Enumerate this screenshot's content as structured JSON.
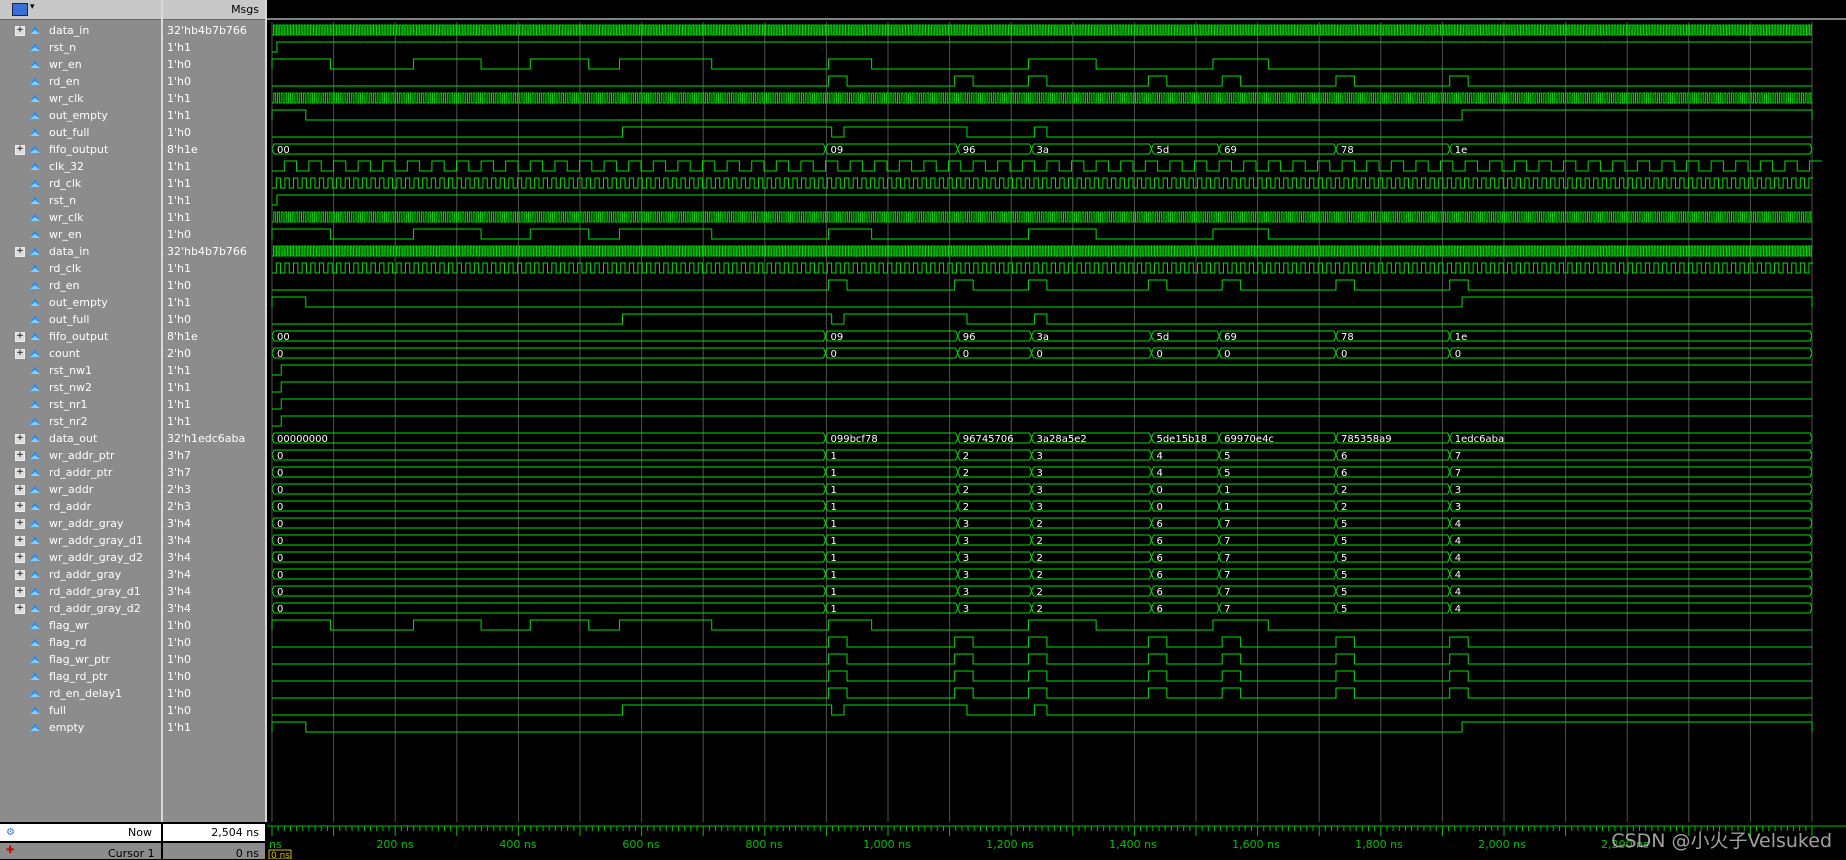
{
  "header": {
    "msgs_label": "Msgs"
  },
  "signals": [
    {
      "name": "data_in",
      "value": "32'hb4b7b766",
      "expand": true,
      "icon": "bus-icon"
    },
    {
      "name": "rst_n",
      "value": "1'h1",
      "expand": false,
      "icon": "wire-icon"
    },
    {
      "name": "wr_en",
      "value": "1'h0",
      "expand": false,
      "icon": "wire-icon"
    },
    {
      "name": "rd_en",
      "value": "1'h0",
      "expand": false,
      "icon": "wire-icon"
    },
    {
      "name": "wr_clk",
      "value": "1'h1",
      "expand": false,
      "icon": "wire-icon"
    },
    {
      "name": "out_empty",
      "value": "1'h1",
      "expand": false,
      "icon": "output-icon"
    },
    {
      "name": "out_full",
      "value": "1'h0",
      "expand": false,
      "icon": "output-icon"
    },
    {
      "name": "fifo_output",
      "value": "8'h1e",
      "expand": true,
      "icon": "bus-output-icon"
    },
    {
      "name": "clk_32",
      "value": "1'h1",
      "expand": false,
      "icon": "output-icon"
    },
    {
      "name": "rd_clk",
      "value": "1'h1",
      "expand": false,
      "icon": "wire-icon"
    },
    {
      "name": "rst_n",
      "value": "1'h1",
      "expand": false,
      "icon": "wire-icon"
    },
    {
      "name": "wr_clk",
      "value": "1'h1",
      "expand": false,
      "icon": "wire-icon"
    },
    {
      "name": "wr_en",
      "value": "1'h0",
      "expand": false,
      "icon": "wire-icon"
    },
    {
      "name": "data_in",
      "value": "32'hb4b7b766",
      "expand": true,
      "icon": "bus-icon"
    },
    {
      "name": "rd_clk",
      "value": "1'h1",
      "expand": false,
      "icon": "wire-icon"
    },
    {
      "name": "rd_en",
      "value": "1'h0",
      "expand": false,
      "icon": "wire-icon"
    },
    {
      "name": "out_empty",
      "value": "1'h1",
      "expand": false,
      "icon": "output-icon"
    },
    {
      "name": "out_full",
      "value": "1'h0",
      "expand": false,
      "icon": "output-icon"
    },
    {
      "name": "fifo_output",
      "value": "8'h1e",
      "expand": true,
      "icon": "bus-output-icon"
    },
    {
      "name": "count",
      "value": "2'h0",
      "expand": true,
      "icon": "bus-icon"
    },
    {
      "name": "rst_nw1",
      "value": "1'h1",
      "expand": false,
      "icon": "reg-icon"
    },
    {
      "name": "rst_nw2",
      "value": "1'h1",
      "expand": false,
      "icon": "reg-icon"
    },
    {
      "name": "rst_nr1",
      "value": "1'h1",
      "expand": false,
      "icon": "reg-icon"
    },
    {
      "name": "rst_nr2",
      "value": "1'h1",
      "expand": false,
      "icon": "reg-icon"
    },
    {
      "name": "data_out",
      "value": "32'h1edc6aba",
      "expand": true,
      "icon": "bus-icon"
    },
    {
      "name": "wr_addr_ptr",
      "value": "3'h7",
      "expand": true,
      "icon": "bus-icon"
    },
    {
      "name": "rd_addr_ptr",
      "value": "3'h7",
      "expand": true,
      "icon": "bus-icon"
    },
    {
      "name": "wr_addr",
      "value": "2'h3",
      "expand": true,
      "icon": "bus-icon"
    },
    {
      "name": "rd_addr",
      "value": "2'h3",
      "expand": true,
      "icon": "bus-icon"
    },
    {
      "name": "wr_addr_gray",
      "value": "3'h4",
      "expand": true,
      "icon": "bus-icon"
    },
    {
      "name": "wr_addr_gray_d1",
      "value": "3'h4",
      "expand": true,
      "icon": "bus-icon"
    },
    {
      "name": "wr_addr_gray_d2",
      "value": "3'h4",
      "expand": true,
      "icon": "bus-icon"
    },
    {
      "name": "rd_addr_gray",
      "value": "3'h4",
      "expand": true,
      "icon": "bus-icon"
    },
    {
      "name": "rd_addr_gray_d1",
      "value": "3'h4",
      "expand": true,
      "icon": "bus-icon"
    },
    {
      "name": "rd_addr_gray_d2",
      "value": "3'h4",
      "expand": true,
      "icon": "bus-icon"
    },
    {
      "name": "flag_wr",
      "value": "1'h0",
      "expand": false,
      "icon": "reg-icon"
    },
    {
      "name": "flag_rd",
      "value": "1'h0",
      "expand": false,
      "icon": "reg-icon"
    },
    {
      "name": "flag_wr_ptr",
      "value": "1'h0",
      "expand": false,
      "icon": "reg-icon"
    },
    {
      "name": "flag_rd_ptr",
      "value": "1'h0",
      "expand": false,
      "icon": "reg-icon"
    },
    {
      "name": "rd_en_delay1",
      "value": "1'h0",
      "expand": false,
      "icon": "reg-icon"
    },
    {
      "name": "full",
      "value": "1'h0",
      "expand": false,
      "icon": "reg-icon"
    },
    {
      "name": "empty",
      "value": "1'h1",
      "expand": false,
      "icon": "reg-icon"
    }
  ],
  "bus_labels": {
    "fifo_output": [
      "00",
      "09",
      "96",
      "3a",
      "5d",
      "69",
      "78",
      "1e"
    ],
    "count": [
      "0",
      "0",
      "0",
      "0",
      "0",
      "0",
      "0",
      "0"
    ],
    "data_out": [
      "00000000",
      "099bcf78",
      "96745706",
      "3a28a5e2",
      "5de15b18",
      "69970e4c",
      "785358a9",
      "1edc6aba"
    ],
    "wr_addr_ptr": [
      "0",
      "1",
      "2",
      "3",
      "4",
      "5",
      "6",
      "7"
    ],
    "rd_addr_ptr": [
      "0",
      "1",
      "2",
      "3",
      "4",
      "5",
      "6",
      "7"
    ],
    "wr_addr": [
      "0",
      "1",
      "2",
      "3",
      "0",
      "1",
      "2",
      "3"
    ],
    "rd_addr": [
      "0",
      "1",
      "2",
      "3",
      "0",
      "1",
      "2",
      "3"
    ],
    "wr_addr_gray": [
      "0",
      "1",
      "3",
      "2",
      "6",
      "7",
      "5",
      "4"
    ],
    "wr_addr_gray_d1": [
      "0",
      "1",
      "3",
      "2",
      "6",
      "7",
      "5",
      "4"
    ],
    "wr_addr_gray_d2": [
      "0",
      "1",
      "3",
      "2",
      "6",
      "7",
      "5",
      "4"
    ],
    "rd_addr_gray": [
      "0",
      "1",
      "3",
      "2",
      "6",
      "7",
      "5",
      "4"
    ],
    "rd_addr_gray_d1": [
      "0",
      "1",
      "3",
      "2",
      "6",
      "7",
      "5",
      "4"
    ],
    "rd_addr_gray_d2": [
      "0",
      "1",
      "3",
      "2",
      "6",
      "7",
      "5",
      "4"
    ]
  },
  "footer": {
    "now_label": "Now",
    "now_value": "2,504 ns",
    "cursor_label": "Cursor 1",
    "cursor_value": "0 ns",
    "cursor_marker": "0 ns",
    "timeline_start": "ns",
    "ticks": [
      "200 ns",
      "400 ns",
      "600 ns",
      "800 ns",
      "1,000 ns",
      "1,200 ns",
      "1,400 ns",
      "1,600 ns",
      "1,800 ns",
      "2,000 ns",
      "2,200 ns"
    ]
  },
  "colors": {
    "wave": "#00e000",
    "grid": "#505050",
    "timeline": "#00c000",
    "panel": "#8c8c8c"
  },
  "watermark": "CSDN @小火子Velsuked"
}
